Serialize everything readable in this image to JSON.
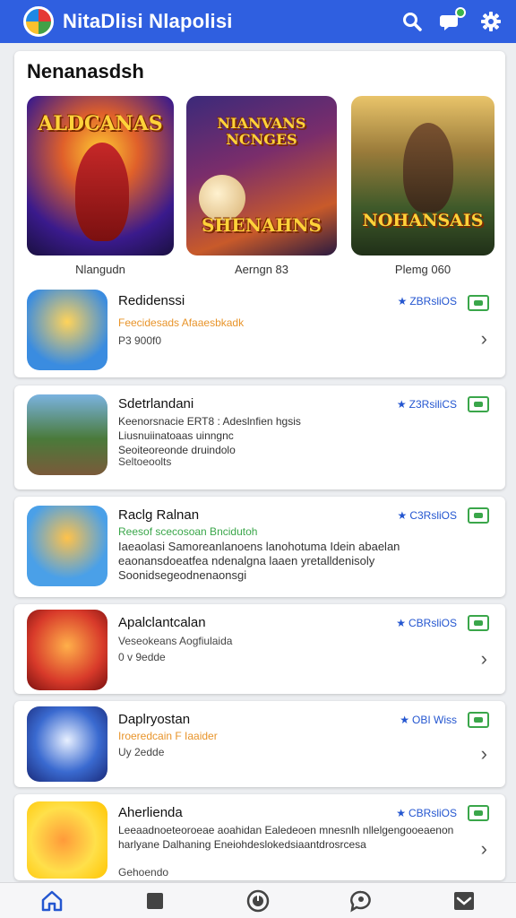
{
  "header": {
    "title": "NitaDlisi Nlapolisi",
    "icons": [
      "search-icon",
      "chat-notification-icon",
      "gear-icon"
    ]
  },
  "featured": {
    "title": "Nenanasdsh",
    "tiles": [
      {
        "art_text": "ALDCANAS",
        "label": "Nlangudn"
      },
      {
        "art_text": "NIANVANS NCNGES",
        "art_text2": "SHENAHNS",
        "label": "Aerngn 83"
      },
      {
        "art_text": "NOHANSAIS",
        "label": "Plemg 060"
      }
    ]
  },
  "apps": [
    {
      "name": "Redidenssi",
      "sub": "Feecidesads Afaaesbkadk",
      "desc": "",
      "meta": "P3 900f0",
      "rating": "ZBRsliOS",
      "chevron": true
    },
    {
      "name": "Sdetrlandani",
      "sub": "",
      "desc": "Keenorsnacie ERT8 : Adeslnfien hgsis",
      "desc2": "Liusnuiinatoaas uinngnc",
      "desc3": "Seoiteoreonde druindolo",
      "meta": "Seltoeoolts",
      "rating": "Z3RsiliCS",
      "chevron": false
    },
    {
      "name": "Raclg Ralnan",
      "sub": "Reesof scecosoan Bncidutoh",
      "desc": "Iaeaolasi Samoreanlanoens lanohotuma Idein abaelan eaonansdoeatfea ndenalgna laaen yretalldenisoly Soonidsegeodnenaonsgi",
      "meta": "",
      "rating": "C3RsliOS",
      "chevron": false
    },
    {
      "name": "Apalclantcalan",
      "sub": "Veseokeans Aogfiulaida",
      "desc": "",
      "meta": "0 v 9edde",
      "rating": "CBRsliOS",
      "chevron": true
    },
    {
      "name": "Daplryostan",
      "sub": "Iroeredcain F Iaaider",
      "desc": "",
      "meta": "Uy 2edde",
      "rating": "OBI Wiss",
      "chevron": true
    },
    {
      "name": "Aherlienda",
      "sub": "",
      "desc": "Leeaadnoeteoroeae aoahidan Ealedeoen mnesnlh nllelgengooeaenon harlyane Dalhaning Eneiohdeslokedsiaantdrosrcesa",
      "meta": "Gehoendo",
      "rating": "CBRsliOS",
      "chevron": true
    }
  ],
  "bottom_nav": [
    "home-icon",
    "stop-square-icon",
    "discover-icon",
    "chat-icon",
    "inbox-icon"
  ],
  "colors": {
    "accent": "#2f5fe0",
    "green": "#3aa64a",
    "orange": "#e8942a"
  }
}
